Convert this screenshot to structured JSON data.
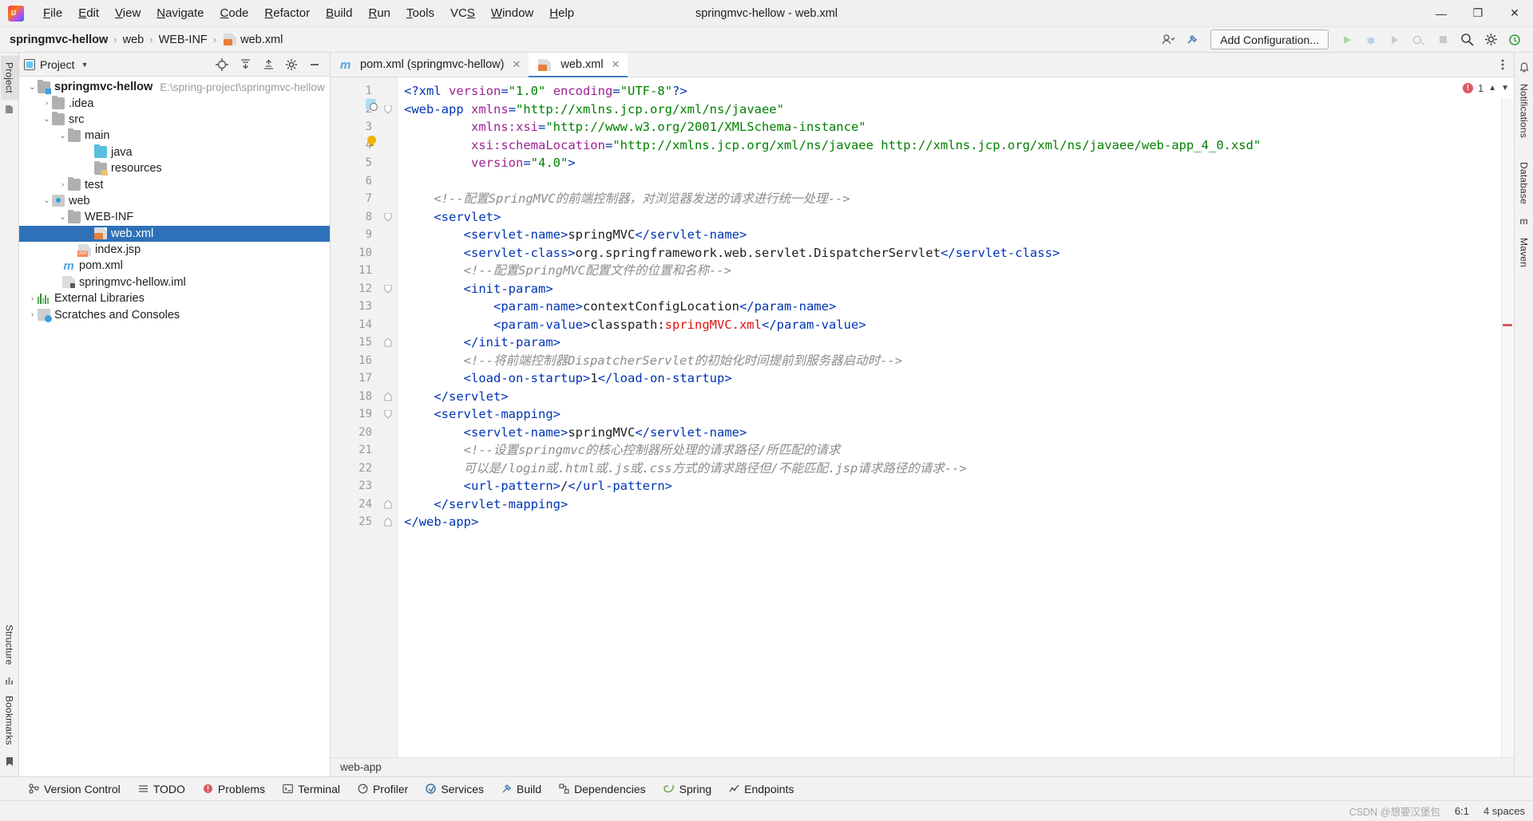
{
  "window": {
    "title": "springmvc-hellow - web.xml",
    "minimize": "—",
    "maximize": "❐",
    "close": "✕"
  },
  "menu": [
    "File",
    "Edit",
    "View",
    "Navigate",
    "Code",
    "Refactor",
    "Build",
    "Run",
    "Tools",
    "VCS",
    "Window",
    "Help"
  ],
  "breadcrumb": {
    "items": [
      "springmvc-hellow",
      "web",
      "WEB-INF",
      "web.xml"
    ],
    "separator": "›"
  },
  "navbar": {
    "run_config_label": "Add Configuration...",
    "icons": [
      "user-settings-icon",
      "hammer-icon",
      "run-icon",
      "debug-icon",
      "run-coverage-icon",
      "profiler-icon",
      "stop-icon",
      "search-icon",
      "settings-icon",
      "updates-icon"
    ]
  },
  "left_strip": {
    "tabs": [
      "Project",
      "Structure",
      "Bookmarks"
    ]
  },
  "right_strip": {
    "tabs": [
      "Notifications",
      "Database",
      "Maven"
    ]
  },
  "project_panel": {
    "title": "Project",
    "toolbar_icons": [
      "locate-icon",
      "collapse-all-icon",
      "expand-all-icon",
      "settings-gear-icon",
      "hide-icon"
    ],
    "tree": [
      {
        "label": "springmvc-hellow",
        "sub": "E:\\spring-project\\springmvc-hellow",
        "indent": 0,
        "arrow": "∨",
        "icon": "module-folder-icon",
        "bold": true,
        "selected": false
      },
      {
        "label": ".idea",
        "sub": "",
        "indent": 1,
        "arrow": "›",
        "icon": "folder-icon",
        "bold": false,
        "selected": false
      },
      {
        "label": "src",
        "sub": "",
        "indent": 1,
        "arrow": "∨",
        "icon": "folder-icon",
        "bold": false,
        "selected": false
      },
      {
        "label": "main",
        "sub": "",
        "indent": 2,
        "arrow": "∨",
        "icon": "folder-icon",
        "bold": false,
        "selected": false
      },
      {
        "label": "java",
        "sub": "",
        "indent": 3,
        "arrow": "",
        "icon": "source-folder-icon",
        "bold": false,
        "selected": false
      },
      {
        "label": "resources",
        "sub": "",
        "indent": 3,
        "arrow": "",
        "icon": "resources-folder-icon",
        "bold": false,
        "selected": false
      },
      {
        "label": "test",
        "sub": "",
        "indent": 2,
        "arrow": "›",
        "icon": "folder-icon",
        "bold": false,
        "selected": false
      },
      {
        "label": "web",
        "sub": "",
        "indent": 1,
        "arrow": "∨",
        "icon": "web-folder-icon",
        "bold": false,
        "selected": false
      },
      {
        "label": "WEB-INF",
        "sub": "",
        "indent": 2,
        "arrow": "∨",
        "icon": "folder-icon",
        "bold": false,
        "selected": false
      },
      {
        "label": "web.xml",
        "sub": "",
        "indent": 3,
        "arrow": "",
        "icon": "xml-file-icon",
        "bold": false,
        "selected": true
      },
      {
        "label": "index.jsp",
        "sub": "",
        "indent": 2,
        "arrow": "",
        "icon": "jsp-file-icon",
        "bold": false,
        "selected": false
      },
      {
        "label": "pom.xml",
        "sub": "",
        "indent": 1,
        "arrow": "",
        "icon": "maven-file-icon",
        "bold": false,
        "selected": false
      },
      {
        "label": "springmvc-hellow.iml",
        "sub": "",
        "indent": 1,
        "arrow": "",
        "icon": "iml-file-icon",
        "bold": false,
        "selected": false
      },
      {
        "label": "External Libraries",
        "sub": "",
        "indent": 0,
        "arrow": "›",
        "icon": "libraries-icon",
        "bold": false,
        "selected": false
      },
      {
        "label": "Scratches and Consoles",
        "sub": "",
        "indent": 0,
        "arrow": "›",
        "icon": "scratches-icon",
        "bold": false,
        "selected": false
      }
    ]
  },
  "editor": {
    "tabs": [
      {
        "label": "pom.xml (springmvc-hellow)",
        "icon": "maven-file-icon",
        "active": false,
        "close": "✕"
      },
      {
        "label": "web.xml",
        "icon": "xml-file-icon",
        "active": true,
        "close": "✕"
      }
    ],
    "highlighted_line": 6,
    "error_count": "1",
    "breadcrumb_footer": "web-app",
    "lines": [
      {
        "n": 1,
        "segments": [
          {
            "t": "<?",
            "c": "punct"
          },
          {
            "t": "xml ",
            "c": "tagname"
          },
          {
            "t": "version",
            "c": "attr"
          },
          {
            "t": "=",
            "c": "punct"
          },
          {
            "t": "\"1.0\"",
            "c": "attrval"
          },
          {
            "t": " ",
            "c": "text"
          },
          {
            "t": "encoding",
            "c": "attr"
          },
          {
            "t": "=",
            "c": "punct"
          },
          {
            "t": "\"UTF-8\"",
            "c": "attrval"
          },
          {
            "t": "?>",
            "c": "punct"
          }
        ]
      },
      {
        "n": 2,
        "segments": [
          {
            "t": "<",
            "c": "punct"
          },
          {
            "t": "web-app",
            "c": "tagname"
          },
          {
            "t": " ",
            "c": "text"
          },
          {
            "t": "xmlns",
            "c": "attr"
          },
          {
            "t": "=",
            "c": "punct"
          },
          {
            "t": "\"http://xmlns.jcp.org/xml/ns/javaee\"",
            "c": "attrval"
          }
        ]
      },
      {
        "n": 3,
        "segments": [
          {
            "t": "         ",
            "c": "text"
          },
          {
            "t": "xmlns:xsi",
            "c": "attr"
          },
          {
            "t": "=",
            "c": "punct"
          },
          {
            "t": "\"http://www.w3.org/2001/XMLSchema-instance\"",
            "c": "attrval"
          }
        ]
      },
      {
        "n": 4,
        "segments": [
          {
            "t": "         ",
            "c": "text"
          },
          {
            "t": "xsi:schemaLocation",
            "c": "attr"
          },
          {
            "t": "=",
            "c": "punct"
          },
          {
            "t": "\"http://xmlns.jcp.org/xml/ns/javaee http://xmlns.jcp.org/xml/ns/javaee/web-app_4_0.xsd\"",
            "c": "attrval"
          }
        ]
      },
      {
        "n": 5,
        "segments": [
          {
            "t": "         ",
            "c": "text"
          },
          {
            "t": "version",
            "c": "attr"
          },
          {
            "t": "=",
            "c": "punct"
          },
          {
            "t": "\"4.0\"",
            "c": "attrval"
          },
          {
            "t": ">",
            "c": "punct"
          }
        ]
      },
      {
        "n": 6,
        "segments": []
      },
      {
        "n": 7,
        "segments": [
          {
            "t": "    <!--配置SpringMVC的前端控制器，对浏览器发送的请求进行统一处理-->",
            "c": "comment"
          }
        ]
      },
      {
        "n": 8,
        "segments": [
          {
            "t": "    ",
            "c": "text"
          },
          {
            "t": "<",
            "c": "punct"
          },
          {
            "t": "servlet",
            "c": "tagname"
          },
          {
            "t": ">",
            "c": "punct"
          }
        ]
      },
      {
        "n": 9,
        "segments": [
          {
            "t": "        ",
            "c": "text"
          },
          {
            "t": "<",
            "c": "punct"
          },
          {
            "t": "servlet-name",
            "c": "tagname"
          },
          {
            "t": ">",
            "c": "punct"
          },
          {
            "t": "springMVC",
            "c": "text"
          },
          {
            "t": "</",
            "c": "punct"
          },
          {
            "t": "servlet-name",
            "c": "tagname"
          },
          {
            "t": ">",
            "c": "punct"
          }
        ]
      },
      {
        "n": 10,
        "segments": [
          {
            "t": "        ",
            "c": "text"
          },
          {
            "t": "<",
            "c": "punct"
          },
          {
            "t": "servlet-class",
            "c": "tagname"
          },
          {
            "t": ">",
            "c": "punct"
          },
          {
            "t": "org.springframework.web.servlet.DispatcherServlet",
            "c": "text"
          },
          {
            "t": "</",
            "c": "punct"
          },
          {
            "t": "servlet-class",
            "c": "tagname"
          },
          {
            "t": ">",
            "c": "punct"
          }
        ]
      },
      {
        "n": 11,
        "segments": [
          {
            "t": "        <!--配置SpringMVC配置文件的位置和名称-->",
            "c": "comment"
          }
        ]
      },
      {
        "n": 12,
        "segments": [
          {
            "t": "        ",
            "c": "text"
          },
          {
            "t": "<",
            "c": "punct"
          },
          {
            "t": "init-param",
            "c": "tagname"
          },
          {
            "t": ">",
            "c": "punct"
          }
        ]
      },
      {
        "n": 13,
        "segments": [
          {
            "t": "            ",
            "c": "text"
          },
          {
            "t": "<",
            "c": "punct"
          },
          {
            "t": "param-name",
            "c": "tagname"
          },
          {
            "t": ">",
            "c": "punct"
          },
          {
            "t": "contextConfigLocation",
            "c": "text"
          },
          {
            "t": "</",
            "c": "punct"
          },
          {
            "t": "param-name",
            "c": "tagname"
          },
          {
            "t": ">",
            "c": "punct"
          }
        ]
      },
      {
        "n": 14,
        "segments": [
          {
            "t": "            ",
            "c": "text"
          },
          {
            "t": "<",
            "c": "punct"
          },
          {
            "t": "param-value",
            "c": "tagname"
          },
          {
            "t": ">",
            "c": "punct"
          },
          {
            "t": "classpath:",
            "c": "text"
          },
          {
            "t": "springMVC.xml",
            "c": "redval"
          },
          {
            "t": "</",
            "c": "punct"
          },
          {
            "t": "param-value",
            "c": "tagname"
          },
          {
            "t": ">",
            "c": "punct"
          }
        ]
      },
      {
        "n": 15,
        "segments": [
          {
            "t": "        ",
            "c": "text"
          },
          {
            "t": "</",
            "c": "punct"
          },
          {
            "t": "init-param",
            "c": "tagname"
          },
          {
            "t": ">",
            "c": "punct"
          }
        ]
      },
      {
        "n": 16,
        "segments": [
          {
            "t": "        <!--将前端控制器DispatcherServlet的初始化时间提前到服务器启动时-->",
            "c": "comment"
          }
        ]
      },
      {
        "n": 17,
        "segments": [
          {
            "t": "        ",
            "c": "text"
          },
          {
            "t": "<",
            "c": "punct"
          },
          {
            "t": "load-on-startup",
            "c": "tagname"
          },
          {
            "t": ">",
            "c": "punct"
          },
          {
            "t": "1",
            "c": "text"
          },
          {
            "t": "</",
            "c": "punct"
          },
          {
            "t": "load-on-startup",
            "c": "tagname"
          },
          {
            "t": ">",
            "c": "punct"
          }
        ]
      },
      {
        "n": 18,
        "segments": [
          {
            "t": "    ",
            "c": "text"
          },
          {
            "t": "</",
            "c": "punct"
          },
          {
            "t": "servlet",
            "c": "tagname"
          },
          {
            "t": ">",
            "c": "punct"
          }
        ]
      },
      {
        "n": 19,
        "segments": [
          {
            "t": "    ",
            "c": "text"
          },
          {
            "t": "<",
            "c": "punct"
          },
          {
            "t": "servlet-mapping",
            "c": "tagname"
          },
          {
            "t": ">",
            "c": "punct"
          }
        ]
      },
      {
        "n": 20,
        "segments": [
          {
            "t": "        ",
            "c": "text"
          },
          {
            "t": "<",
            "c": "punct"
          },
          {
            "t": "servlet-name",
            "c": "tagname"
          },
          {
            "t": ">",
            "c": "punct"
          },
          {
            "t": "springMVC",
            "c": "text"
          },
          {
            "t": "</",
            "c": "punct"
          },
          {
            "t": "servlet-name",
            "c": "tagname"
          },
          {
            "t": ">",
            "c": "punct"
          }
        ]
      },
      {
        "n": 21,
        "segments": [
          {
            "t": "        <!--设置springmvc的核心控制器所处理的请求路径/所匹配的请求",
            "c": "comment"
          }
        ]
      },
      {
        "n": 22,
        "segments": [
          {
            "t": "        可以是/login或.html或.js或.css方式的请求路径但/不能匹配.jsp请求路径的请求-->",
            "c": "comment"
          }
        ]
      },
      {
        "n": 23,
        "segments": [
          {
            "t": "        ",
            "c": "text"
          },
          {
            "t": "<",
            "c": "punct"
          },
          {
            "t": "url-pattern",
            "c": "tagname"
          },
          {
            "t": ">",
            "c": "punct"
          },
          {
            "t": "/",
            "c": "text"
          },
          {
            "t": "</",
            "c": "punct"
          },
          {
            "t": "url-pattern",
            "c": "tagname"
          },
          {
            "t": ">",
            "c": "punct"
          }
        ]
      },
      {
        "n": 24,
        "segments": [
          {
            "t": "    ",
            "c": "text"
          },
          {
            "t": "</",
            "c": "punct"
          },
          {
            "t": "servlet-mapping",
            "c": "tagname"
          },
          {
            "t": ">",
            "c": "punct"
          }
        ]
      },
      {
        "n": 25,
        "segments": [
          {
            "t": "</",
            "c": "punct"
          },
          {
            "t": "web-app",
            "c": "tagname"
          },
          {
            "t": ">",
            "c": "punct"
          }
        ]
      }
    ]
  },
  "bottom_bar": {
    "items": [
      {
        "label": "Version Control",
        "icon": "branch-icon"
      },
      {
        "label": "TODO",
        "icon": "list-icon"
      },
      {
        "label": "Problems",
        "icon": "error-icon"
      },
      {
        "label": "Terminal",
        "icon": "terminal-icon"
      },
      {
        "label": "Profiler",
        "icon": "profiler-icon"
      },
      {
        "label": "Services",
        "icon": "services-icon"
      },
      {
        "label": "Build",
        "icon": "hammer-icon"
      },
      {
        "label": "Dependencies",
        "icon": "dependencies-icon"
      },
      {
        "label": "Spring",
        "icon": "spring-leaf-icon"
      },
      {
        "label": "Endpoints",
        "icon": "endpoints-icon"
      }
    ]
  },
  "status_bar": {
    "caret": "6:1",
    "indent": "4 spaces",
    "watermark": "CSDN @想要汉堡包"
  },
  "colors": {
    "accent": "#2f71b8",
    "tag": "#0033b3",
    "attr": "#9b2393",
    "value": "#008000",
    "comment": "#8c8c8c",
    "error": "#db5860",
    "highlight_line": "#fdf9e6"
  }
}
